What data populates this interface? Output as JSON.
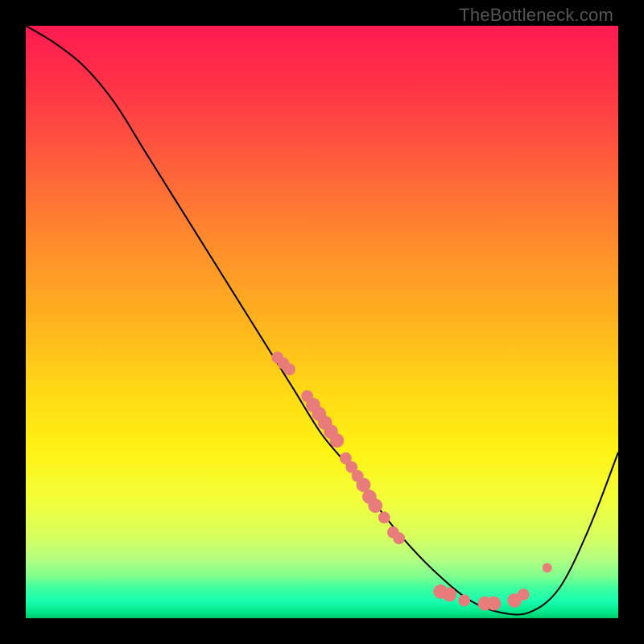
{
  "attribution": "TheBottleneck.com",
  "colors": {
    "curve_stroke": "#000000",
    "dot_fill": "#e77c7a",
    "dot_stroke": "#e77c7a",
    "background_frame": "#000000"
  },
  "chart_data": {
    "type": "line",
    "title": "",
    "xlabel": "",
    "ylabel": "",
    "xlim": [
      0,
      100
    ],
    "ylim": [
      0,
      100
    ],
    "grid": false,
    "legend": false,
    "series": [
      {
        "name": "bottleneck-curve",
        "note": "Approximate y value along the curve as a function of x (both 0–100, origin bottom-left). Values estimated visually from the plot.",
        "x": [
          0,
          5,
          10,
          15,
          20,
          25,
          30,
          35,
          40,
          45,
          50,
          55,
          60,
          65,
          70,
          75,
          80,
          85,
          90,
          95,
          100
        ],
        "y": [
          100,
          97,
          93,
          87,
          79,
          71,
          63,
          55,
          47,
          39,
          31,
          25,
          18,
          12,
          7,
          3,
          1,
          1,
          5,
          15,
          28
        ]
      }
    ],
    "scatter": {
      "name": "highlighted-points",
      "note": "Dot markers overlaid on the curve; visually estimated (x,y) positions and approximate radius in plot units.",
      "points": [
        {
          "x": 42.5,
          "y": 44.0,
          "r": 1.0
        },
        {
          "x": 43.5,
          "y": 43.0,
          "r": 1.0
        },
        {
          "x": 44.5,
          "y": 42.0,
          "r": 1.0
        },
        {
          "x": 47.5,
          "y": 37.5,
          "r": 1.0
        },
        {
          "x": 48.5,
          "y": 36.0,
          "r": 1.2
        },
        {
          "x": 49.5,
          "y": 34.5,
          "r": 1.2
        },
        {
          "x": 50.5,
          "y": 33.0,
          "r": 1.2
        },
        {
          "x": 51.5,
          "y": 31.5,
          "r": 1.2
        },
        {
          "x": 52.5,
          "y": 30.0,
          "r": 1.2
        },
        {
          "x": 54.0,
          "y": 27.0,
          "r": 1.0
        },
        {
          "x": 55.0,
          "y": 25.5,
          "r": 1.0
        },
        {
          "x": 56.0,
          "y": 24.0,
          "r": 1.0
        },
        {
          "x": 57.0,
          "y": 22.5,
          "r": 1.2
        },
        {
          "x": 58.0,
          "y": 20.5,
          "r": 1.2
        },
        {
          "x": 59.0,
          "y": 19.0,
          "r": 1.2
        },
        {
          "x": 60.5,
          "y": 17.0,
          "r": 1.0
        },
        {
          "x": 62.0,
          "y": 14.5,
          "r": 1.0
        },
        {
          "x": 63.0,
          "y": 13.5,
          "r": 1.0
        },
        {
          "x": 70.0,
          "y": 4.5,
          "r": 1.2
        },
        {
          "x": 71.5,
          "y": 4.0,
          "r": 1.2
        },
        {
          "x": 74.0,
          "y": 3.0,
          "r": 1.0
        },
        {
          "x": 77.5,
          "y": 2.5,
          "r": 1.2
        },
        {
          "x": 79.0,
          "y": 2.5,
          "r": 1.2
        },
        {
          "x": 82.5,
          "y": 3.0,
          "r": 1.2
        },
        {
          "x": 84.0,
          "y": 4.0,
          "r": 1.0
        },
        {
          "x": 88.0,
          "y": 8.5,
          "r": 0.8
        }
      ]
    },
    "background": {
      "type": "vertical-gradient",
      "stops": [
        {
          "pos": 0.0,
          "color": "#ff1a4f"
        },
        {
          "pos": 0.5,
          "color": "#ffda14"
        },
        {
          "pos": 0.8,
          "color": "#f2ff3a"
        },
        {
          "pos": 0.93,
          "color": "#7dff8e"
        },
        {
          "pos": 1.0,
          "color": "#00c86a"
        }
      ]
    }
  }
}
